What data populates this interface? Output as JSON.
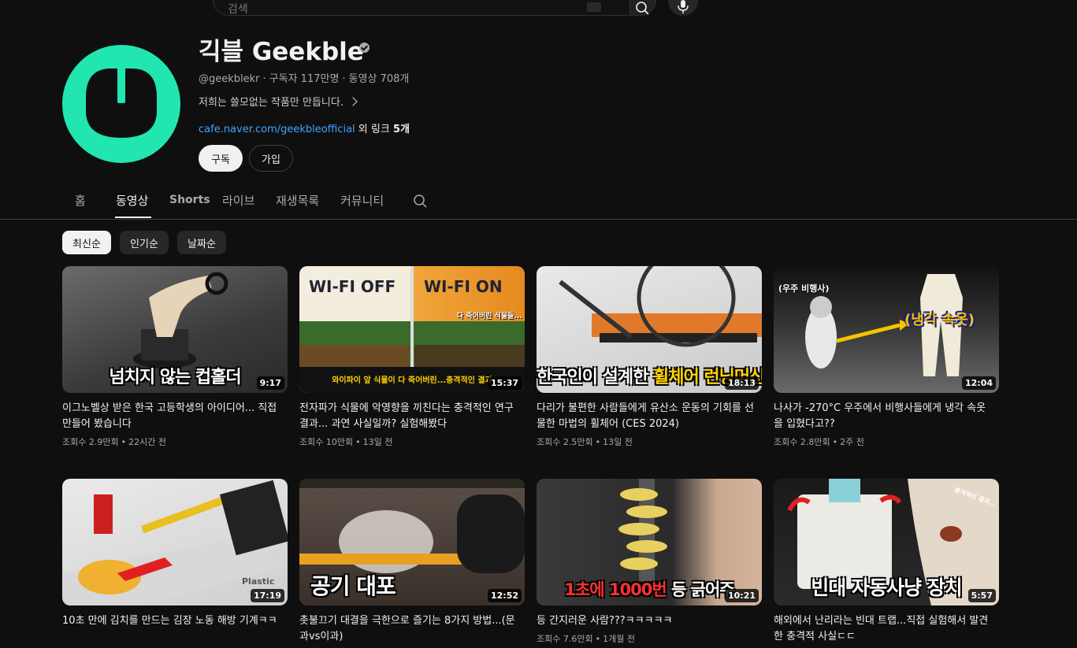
{
  "search": {
    "placeholder": "검색"
  },
  "channel": {
    "name": "긱블 Geekble",
    "handle": "@geekblekr",
    "subscribers": "구독자 117만명",
    "video_count": "동영상 708개",
    "description": "저희는 쓸모없는 작품만 만듭니다.",
    "link_url": "cafe.naver.com/geekbleofficial",
    "link_more_prefix": "외 링크",
    "link_more_count": "5개",
    "subscribe_label": "구독",
    "join_label": "가입",
    "brand_color": "#21e6b0"
  },
  "tabs": [
    {
      "label": "홈",
      "active": false
    },
    {
      "label": "동영상",
      "active": true
    },
    {
      "label": "Shorts",
      "active": false
    },
    {
      "label": "라이브",
      "active": false
    },
    {
      "label": "재생목록",
      "active": false
    },
    {
      "label": "커뮤니티",
      "active": false
    }
  ],
  "chips": [
    {
      "label": "최신순",
      "selected": true
    },
    {
      "label": "인기순",
      "selected": false
    },
    {
      "label": "날짜순",
      "selected": false
    }
  ],
  "videos": [
    {
      "thumb_text": "넘치지 않는 컵홀더",
      "duration": "9:17",
      "title": "이그노벨상 받은 한국 고등학생의 아이디어... 직접 만들어 봤습니다",
      "views": "조회수 2.9만회",
      "age": "22시간 전"
    },
    {
      "thumb_text_left": "WI-FI OFF",
      "thumb_text_right": "WI-FI ON",
      "thumb_small_label": "다 죽어버린 식물들...",
      "thumb_caption": "와이파이 앞 식물이 다 죽어버린...충격적인 결과",
      "duration": "15:37",
      "title": "전자파가 식물에 악영향을 끼친다는 충격적인 연구결과... 과연 사실일까? 실험해봤다",
      "views": "조회수 10만회",
      "age": "13일 전"
    },
    {
      "thumb_text": "한국인이 설계한 휠체어 런닝머신",
      "thumb_text_white": "한국인이 설계한 ",
      "thumb_text_yellow": "휠체어 런닝머신",
      "duration": "18:13",
      "title": "다리가 불편한 사람들에게 유산소 운동의 기회를 선물한 마법의 휠체어 (CES 2024)",
      "views": "조회수 2.5만회",
      "age": "13일 전"
    },
    {
      "thumb_label_left": "(우주 비행사)",
      "thumb_label_right": "(냉각 속옷)",
      "duration": "12:04",
      "title": "나사가 -270°C 우주에서 비행사들에게 냉각 속옷을 입혔다고??",
      "views": "조회수 2.8만회",
      "age": "2주 전"
    },
    {
      "thumb_text": "",
      "thumb_small_label": "Plastic",
      "duration": "17:19",
      "title": "10초 만에 김치를 만드는 김장 노동 해방 기계ㅋㅋ",
      "views": "",
      "age": ""
    },
    {
      "thumb_text": "공기 대포",
      "duration": "12:52",
      "title": "촛불끄기 대결을 극한으로 즐기는 8가지 방법...(문과vs이과)",
      "views": "",
      "age": ""
    },
    {
      "thumb_text_red": "1초에 1000번",
      "thumb_text_white": " 등 긁어주",
      "duration": "10:21",
      "title": "등 간지러운 사람???ㅋㅋㅋㅋㅋ",
      "views": "조회수 7.6만회",
      "age": "1개월 전"
    },
    {
      "thumb_text": "빈대 자동사냥 장치",
      "thumb_small_label": "충격적인 결과...",
      "duration": "5:57",
      "title": "해외에서 난리라는 빈대 트랩...직접 실험해서 발견한 충격적 사실ㄷㄷ",
      "views": "",
      "age": ""
    }
  ]
}
